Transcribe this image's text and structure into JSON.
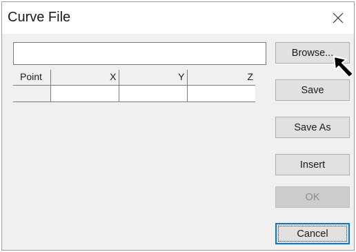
{
  "dialog": {
    "title": "Curve File",
    "close_icon": "close-icon"
  },
  "file": {
    "path_value": "",
    "placeholder": ""
  },
  "grid": {
    "columns": [
      "Point",
      "X",
      "Y",
      "Z"
    ],
    "rows": [
      [
        "",
        "",
        "",
        ""
      ]
    ]
  },
  "buttons": {
    "browse": "Browse...",
    "save": "Save",
    "save_as": "Save As",
    "insert": "Insert",
    "ok": "OK",
    "cancel": "Cancel"
  },
  "colors": {
    "accent": "#0078d7",
    "button_face": "#e1e1e1",
    "disabled_face": "#cccccc"
  },
  "cursor": {
    "icon": "arrow-cursor-icon"
  }
}
